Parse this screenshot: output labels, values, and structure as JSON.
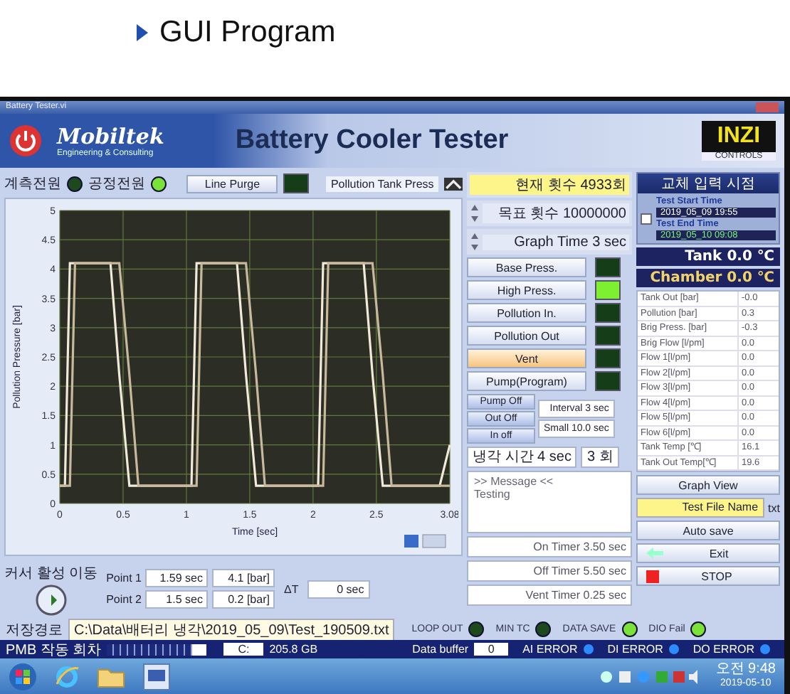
{
  "slide": {
    "title": "GUI Program"
  },
  "window": {
    "title": "Battery Tester.vi"
  },
  "header": {
    "brand": "Mobiltek",
    "tagline": "Engineering & Consulting",
    "title": "Battery Cooler Tester",
    "partner": "INZI",
    "partner_sub": "CONTROLS"
  },
  "indicators": [
    {
      "label": "계측전원",
      "on": false
    },
    {
      "label": "공정전원",
      "on": true
    }
  ],
  "line_purge": {
    "label": "Line Purge",
    "on": false
  },
  "tank_press": {
    "label": "Pollution Tank Press"
  },
  "chart": {
    "chart_data": {
      "type": "line",
      "xlabel": "Time [sec]",
      "ylabel": "Pollution Pressure [bar]",
      "x": [
        0,
        0.04,
        0.08,
        0.12,
        0.4,
        0.47,
        0.55,
        0.62,
        1.0,
        1.04,
        1.08,
        1.12,
        1.4,
        1.47,
        1.55,
        1.62,
        2.0,
        2.04,
        2.08,
        2.12,
        2.4,
        2.47,
        2.55,
        2.62,
        3.0,
        3.08
      ],
      "series": [
        {
          "color": "#f2ead8",
          "values": [
            0.3,
            0.3,
            4.1,
            4.1,
            4.1,
            2.2,
            0.3,
            0.3,
            0.3,
            0.3,
            4.1,
            4.1,
            4.1,
            2.2,
            0.3,
            0.3,
            0.3,
            0.3,
            4.1,
            4.1,
            4.1,
            2.2,
            0.3,
            0.3,
            0.3,
            1.0
          ]
        },
        {
          "color": "#c9b99c",
          "values": [
            0.3,
            0.3,
            0.3,
            4.1,
            4.1,
            4.1,
            2.2,
            0.3,
            0.3,
            0.3,
            0.3,
            4.1,
            4.1,
            4.1,
            2.2,
            0.3,
            0.3,
            0.3,
            0.3,
            4.1,
            4.1,
            4.1,
            2.2,
            0.3,
            0.3,
            0.3
          ]
        }
      ],
      "grid": true,
      "xlim": [
        0,
        3.08
      ],
      "ylim": [
        0,
        5
      ],
      "xticks": [
        0,
        0.5,
        1,
        1.5,
        2,
        2.5,
        3.08
      ],
      "yticks": [
        0,
        0.5,
        1,
        1.5,
        2,
        2.5,
        3,
        3.5,
        4,
        4.5,
        5
      ]
    }
  },
  "cursor": {
    "label": "커서 활성 이동",
    "points": [
      {
        "label": "Point 1",
        "time": "1.59 sec",
        "value": "4.1 [bar]"
      },
      {
        "label": "Point 2",
        "time": "1.5 sec",
        "value": "0.2 [bar]"
      }
    ],
    "delta_label": "ΔT",
    "delta": "0 sec"
  },
  "counters": [
    {
      "kind": "display",
      "text": "현재 횟수 4933회"
    },
    {
      "kind": "spinner",
      "text": "목표 횟수 10000000"
    },
    {
      "kind": "spinner",
      "text": "Graph Time 3 sec"
    }
  ],
  "valves": [
    {
      "label": "Base Press.",
      "pressed": false,
      "on": false
    },
    {
      "label": "High Press.",
      "pressed": false,
      "on": true
    },
    {
      "label": "Pollution In.",
      "pressed": false,
      "on": false
    },
    {
      "label": "Pollution Out",
      "pressed": false,
      "on": false
    },
    {
      "label": "Vent",
      "pressed": true,
      "on": false
    },
    {
      "label": "Pump(Program)",
      "pressed": false,
      "on": false
    }
  ],
  "modes": [
    "Pump Off",
    "Out Off",
    "In off"
  ],
  "intervals": [
    "Interval 3 sec",
    "Small 10.0 sec"
  ],
  "settings": [
    "냉각 시간 4 sec",
    "3 회"
  ],
  "message": {
    "title": ">> Message <<",
    "text": "Testing"
  },
  "timers": [
    "On Timer 3.50 sec",
    "Off Timer 5.50 sec",
    "Vent Timer 0.25 sec"
  ],
  "schedule": {
    "title": "교체 입력 시점",
    "checked": false,
    "start_label": "Test Start Time",
    "start": "2019_05_09 19:55",
    "end_label": "Test End Time",
    "end": "2019_05_10 09:08"
  },
  "temps": [
    {
      "kind": "tank",
      "text": "Tank 0.0 ℃"
    },
    {
      "kind": "chamber",
      "text": "Chamber 0.0 ℃"
    }
  ],
  "readings": [
    {
      "name": "Tank Out [bar]",
      "value": "-0.0"
    },
    {
      "name": "Pollution [bar]",
      "value": "0.3"
    },
    {
      "name": "Brig Press. [bar]",
      "value": "-0.3"
    },
    {
      "name": "Brig Flow [l/pm]",
      "value": "0.0"
    },
    {
      "name": "Flow 1[l/pm]",
      "value": "0.0"
    },
    {
      "name": "Flow 2[l/pm]",
      "value": "0.0"
    },
    {
      "name": "Flow 3[l/pm]",
      "value": "0.0"
    },
    {
      "name": "Flow 4[l/pm]",
      "value": "0.0"
    },
    {
      "name": "Flow 5[l/pm]",
      "value": "0.0"
    },
    {
      "name": "Flow 6[l/pm]",
      "value": "0.0"
    },
    {
      "name": "Tank Temp [℃]",
      "value": "16.1"
    },
    {
      "name": "Tank Out Temp[℃]",
      "value": "19.6"
    }
  ],
  "graph_view": "Graph View",
  "file_name": "Test File Name",
  "file_ext": "txt",
  "save_mode": "Auto save",
  "exit": "Exit",
  "stop": "STOP",
  "path": {
    "label": "저장경로",
    "value": "C:\\Data\\배터리 냉각\\2019_05_09\\Test_190509.txt"
  },
  "leds": [
    {
      "label": "LOOP OUT",
      "on": false
    },
    {
      "label": "MIN TC",
      "on": false
    },
    {
      "label": "DATA SAVE",
      "on": true
    },
    {
      "label": "DIO Fail",
      "on": true
    }
  ],
  "status": {
    "count_label": "PMB 작동 회차",
    "level": 0.85,
    "drive": "C:",
    "free": "205.8 GB",
    "buffer_label": "Data buffer",
    "buffer": "0",
    "errors": [
      {
        "label": "AI ERROR",
        "on": true
      },
      {
        "label": "DI ERROR",
        "on": true
      },
      {
        "label": "DO ERROR",
        "on": true
      }
    ]
  },
  "taskbar": {
    "time": "오전 9:48",
    "date": "2019-05-10"
  }
}
